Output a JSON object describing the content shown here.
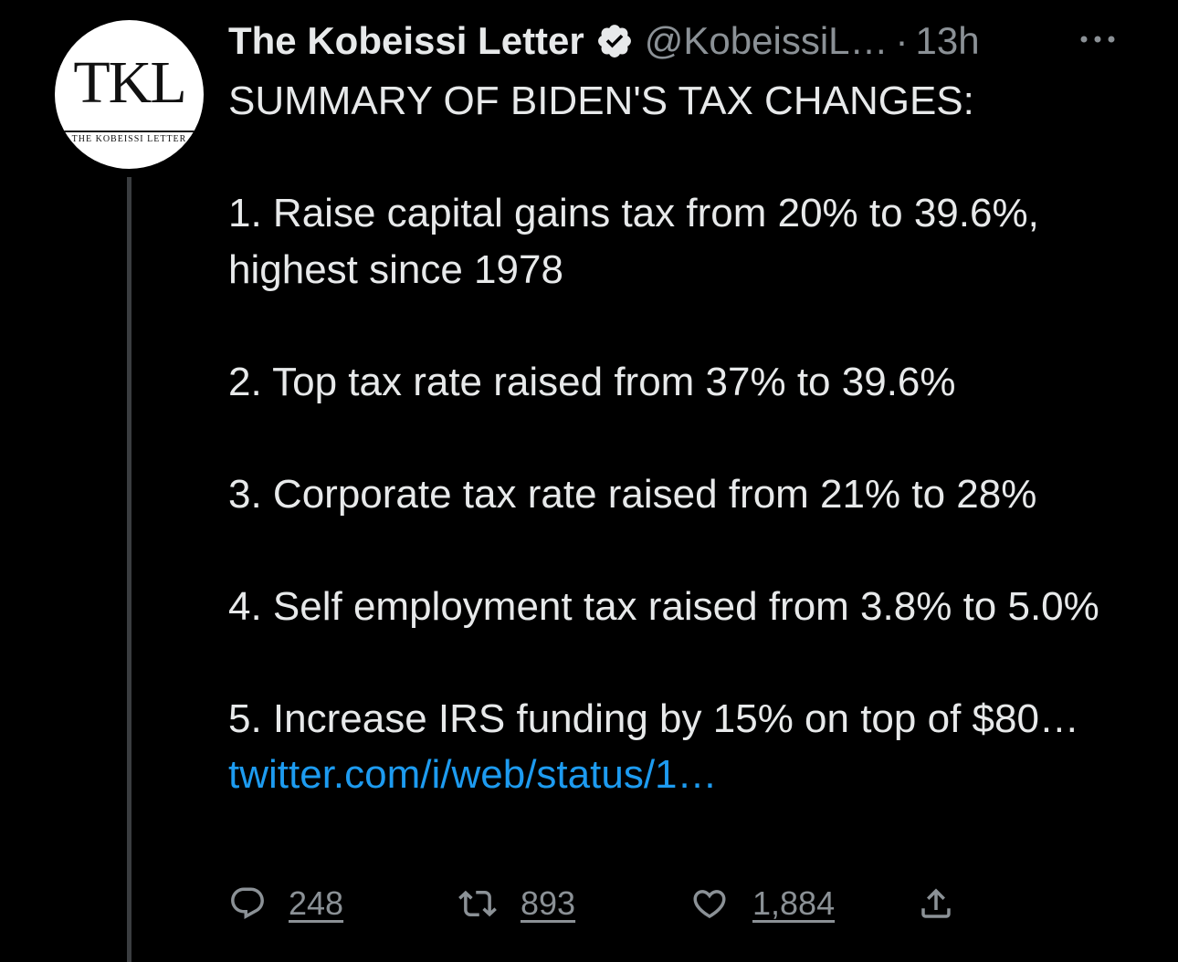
{
  "author": {
    "display_name": "The Kobeissi Letter",
    "handle": "@KobeissiL…",
    "separator": "·",
    "time": "13h",
    "avatar": {
      "monogram": "TKL",
      "caption": "THE KOBEISSI LETTER",
      "background": "#ffffff"
    },
    "verified_icon": "verified-badge-icon"
  },
  "tweet": {
    "heading": "SUMMARY OF BIDEN'S TAX CHANGES:",
    "items": [
      "1. Raise capital gains tax from 20% to 39.6%, highest since 1978",
      "2. Top tax rate raised from 37% to 39.6%",
      "3. Corporate tax rate raised from 21% to 28%",
      "4. Self employment tax raised from 3.8% to 5.0%"
    ],
    "last_item_text": "5. Increase IRS funding by 15% on top of $80…",
    "link_text": "twitter.com/i/web/status/1…"
  },
  "actions": {
    "reply": {
      "icon": "reply-icon",
      "count": "248"
    },
    "retweet": {
      "icon": "retweet-icon",
      "count": "893"
    },
    "like": {
      "icon": "heart-icon",
      "count": "1,884"
    },
    "share": {
      "icon": "share-icon"
    }
  },
  "colors": {
    "background": "#000000",
    "text": "#e7e9ea",
    "muted": "#8b9196",
    "link": "#1d9bf0",
    "thread_line": "#3a3d40"
  }
}
